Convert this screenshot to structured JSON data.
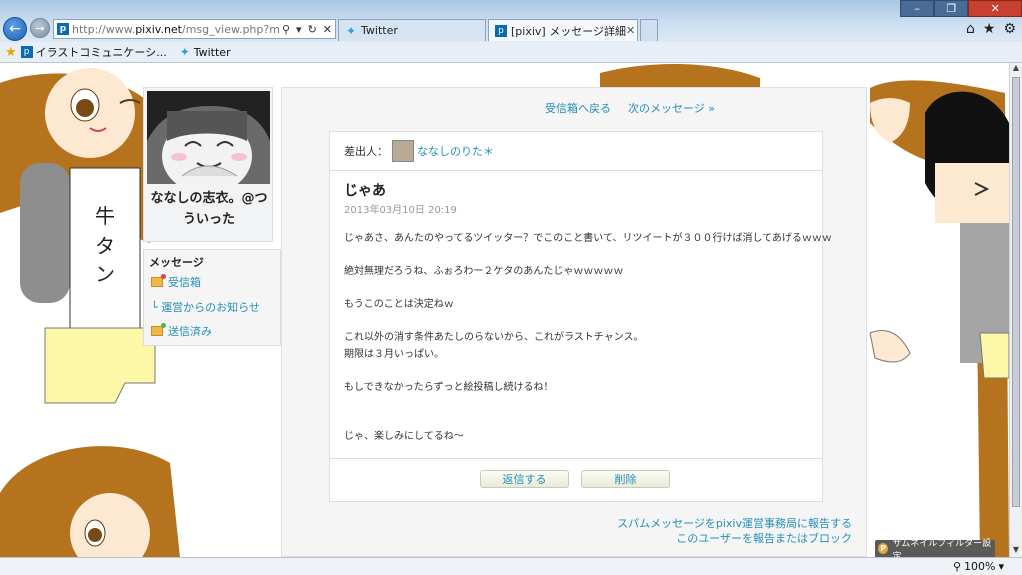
{
  "browser": {
    "address": {
      "domain_prefix": "http://www.",
      "domain": "pixiv.net",
      "path": "/msg_view.php?mode=get&"
    },
    "tabs": [
      {
        "label": "Twitter",
        "icon": "twitter-bird-icon"
      },
      {
        "label": "[pixiv] メッセージ詳細",
        "icon": "pixiv-icon",
        "active": true
      }
    ],
    "favorites": [
      {
        "label": "イラストコミュニケーシ...",
        "icon": "pixiv-icon"
      },
      {
        "label": "Twitter",
        "icon": "twitter-bird-icon"
      }
    ],
    "window_controls": [
      "minimize",
      "restore",
      "close"
    ],
    "zoom": "100%"
  },
  "sidebar": {
    "username": "ななしの志衣。@つういった",
    "menu_title": "メッセージ",
    "menu": [
      {
        "label": "受信箱",
        "icon": "folder-icon"
      },
      {
        "label": "└ 運営からのお知らせ",
        "icon": ""
      },
      {
        "label": "送信済み",
        "icon": "folder-icon"
      }
    ]
  },
  "nav": {
    "back": "受信箱へ戻る",
    "next": "次のメッセージ »"
  },
  "message": {
    "sender_label": "差出人：",
    "sender_name": "ななしのりた＊",
    "subject": "じゃあ",
    "date": "2013年03月10日 20:19",
    "body": [
      "じゃあさ、あんたのやってるツイッター？でこのこと書いて、リツイートが３００行けば消してあげるｗｗｗ",
      "",
      "絶対無理だろうね、ふぉろわー２ケタのあんたじゃｗｗｗｗｗ",
      "",
      "もうこのことは決定ねｗ",
      "",
      "これ以外の消す条件あたしのらないから、これがラストチャンス。",
      "期限は３月いっぱい。",
      "",
      "もしできなかったらずっと絵投稿し続けるね！",
      "",
      "",
      "じゃ、楽しみにしてるね～"
    ],
    "reply_button": "返信する",
    "delete_button": "削除"
  },
  "footer": {
    "report_spam": "スパムメッセージをpixiv運営事務局に報告する",
    "report_user": "このユーザーを報告またはブロック",
    "thumbnail_filter": "サムネイルフィルター設定"
  },
  "colors": {
    "link": "#258fb8",
    "panel_bg": "#f5f5f5",
    "chrome_blue": "#aac6e3"
  }
}
